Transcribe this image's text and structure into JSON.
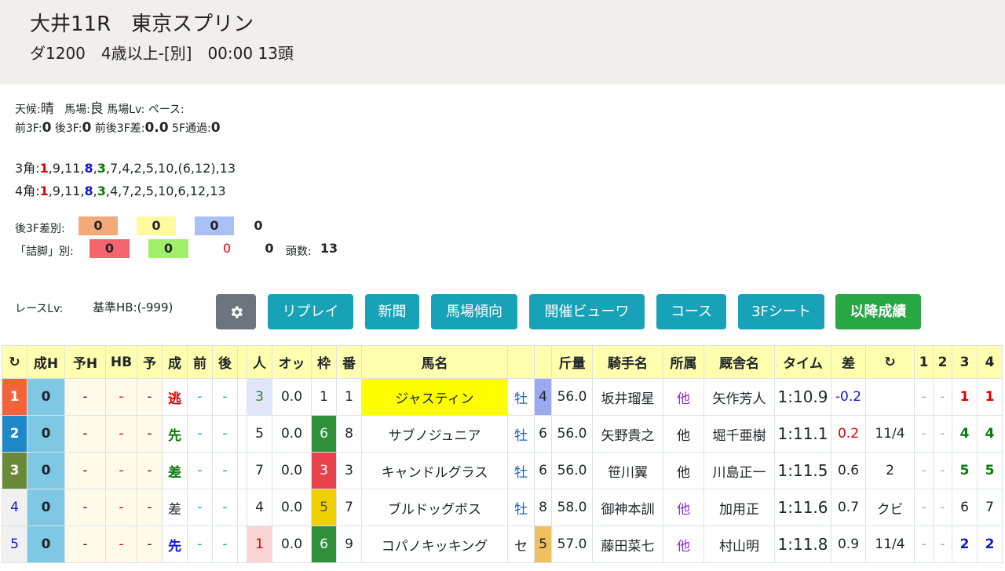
{
  "race": {
    "title": "大井11R　東京スプリン",
    "subtitle": "ダ1200　4歳以上-[別]　00:00 13頭"
  },
  "conditions": {
    "weather_label": "天候:",
    "weather": "晴",
    "track_label": "馬場:",
    "track": "良",
    "track_lv_label": "馬場Lv:",
    "pace_label": "ペース:",
    "f3_label": "前3F:",
    "f3": "0",
    "l3_label": "後3F:",
    "l3": "0",
    "diff_label": "前後3F差:",
    "diff": "0.0",
    "pass5_label": "5F通過:",
    "pass5": "0"
  },
  "corners": {
    "c3_label": "3角:",
    "c3_rest": ",9,11,",
    "c3_tail": ",7,4,2,5,10,(6,12),13",
    "c4_label": "4角:",
    "c4_rest": ",9,11,",
    "c4_tail": ",4,7,2,5,10,6,12,13",
    "first": "1",
    "second": "8",
    "third": "3"
  },
  "stats": {
    "l3_diff_label": "後3F差別:",
    "l3_vals": [
      "0",
      "0",
      "0",
      "0"
    ],
    "tsume_label": "「詰脚」別:",
    "tsume_vals": [
      "0",
      "0",
      "0",
      "0"
    ],
    "count_label": "頭数:",
    "count": "13",
    "colors": {
      "orange": "#f4a97a",
      "yellow": "#fffa9e",
      "blue": "#aac0f5",
      "red": "#f4646e",
      "green": "#a0f06a"
    }
  },
  "race_lv": {
    "label": "レースLv:",
    "hb": "基準HB:(-999)"
  },
  "buttons": {
    "settings": "gear-icon",
    "replay": "リプレイ",
    "news": "新聞",
    "track_trend": "馬場傾向",
    "meeting_view": "開催ビューワ",
    "course": "コース",
    "sheet3f": "3Fシート",
    "later": "以降成績"
  },
  "table": {
    "headers": [
      "↻",
      "成H",
      "予H",
      "HB",
      "予",
      "成",
      "前",
      "後",
      "",
      "人",
      "オッ",
      "枠",
      "番",
      "馬名",
      "",
      "",
      "斤量",
      "騎手名",
      "所属",
      "厩舎名",
      "タイム",
      "差",
      "↻",
      "1",
      "2",
      "3",
      "4"
    ],
    "rows": [
      {
        "rank": "1",
        "seiH": "0",
        "yoH": "-",
        "hb": "-",
        "yo": "-",
        "sei": "逃",
        "mae": "-",
        "ato": "-",
        "pop": "3",
        "odds": "0.0",
        "waku": "1",
        "ban": "1",
        "name": "ジャスティン",
        "sex": "牡",
        "age": "4",
        "kin": "56.0",
        "jockey": "坂井瑠星",
        "aff": "他",
        "trainer": "矢作芳人",
        "time": "1:10.9",
        "gap": "-0.2",
        "margin": "",
        "p1": "-",
        "p2": "-",
        "p3": "1",
        "p4": "1"
      },
      {
        "rank": "2",
        "seiH": "0",
        "yoH": "-",
        "hb": "-",
        "yo": "-",
        "sei": "先",
        "mae": "-",
        "ato": "-",
        "pop": "5",
        "odds": "0.0",
        "waku": "6",
        "ban": "8",
        "name": "サブノジュニア",
        "sex": "牡",
        "age": "6",
        "kin": "56.0",
        "jockey": "矢野貴之",
        "aff": "他",
        "trainer": "堀千亜樹",
        "time": "1:11.1",
        "gap": "0.2",
        "margin": "11/4",
        "p1": "-",
        "p2": "-",
        "p3": "4",
        "p4": "4"
      },
      {
        "rank": "3",
        "seiH": "0",
        "yoH": "-",
        "hb": "-",
        "yo": "-",
        "sei": "差",
        "mae": "-",
        "ato": "-",
        "pop": "7",
        "odds": "0.0",
        "waku": "3",
        "ban": "3",
        "name": "キャンドルグラス",
        "sex": "牡",
        "age": "6",
        "kin": "56.0",
        "jockey": "笹川翼",
        "aff": "他",
        "trainer": "川島正一",
        "time": "1:11.5",
        "gap": "0.6",
        "margin": "2",
        "p1": "-",
        "p2": "-",
        "p3": "5",
        "p4": "5"
      },
      {
        "rank": "4",
        "seiH": "0",
        "yoH": "-",
        "hb": "-",
        "yo": "-",
        "sei": "差",
        "mae": "-",
        "ato": "-",
        "pop": "4",
        "odds": "0.0",
        "waku": "5",
        "ban": "7",
        "name": "ブルドッグボス",
        "sex": "牡",
        "age": "8",
        "kin": "58.0",
        "jockey": "御神本訓",
        "aff": "他",
        "trainer": "加用正",
        "time": "1:11.6",
        "gap": "0.7",
        "margin": "クビ",
        "p1": "-",
        "p2": "-",
        "p3": "6",
        "p4": "7"
      },
      {
        "rank": "5",
        "seiH": "0",
        "yoH": "-",
        "hb": "-",
        "yo": "-",
        "sei": "先",
        "mae": "-",
        "ato": "-",
        "pop": "1",
        "odds": "0.0",
        "waku": "6",
        "ban": "9",
        "name": "コパノキッキング",
        "sex": "セ",
        "age": "5",
        "kin": "57.0",
        "jockey": "藤田菜七",
        "aff": "他",
        "trainer": "村山明",
        "time": "1:11.8",
        "gap": "0.9",
        "margin": "11/4",
        "p1": "-",
        "p2": "-",
        "p3": "2",
        "p4": "2"
      }
    ],
    "colors": {
      "rank1": "#f4623a",
      "rank2": "#1e88c8",
      "rank3": "#6a8a3a",
      "waku1": "#ffffff",
      "waku3": "#e8424e",
      "waku5": "#f0d000",
      "waku6": "#2f8f3a"
    }
  }
}
